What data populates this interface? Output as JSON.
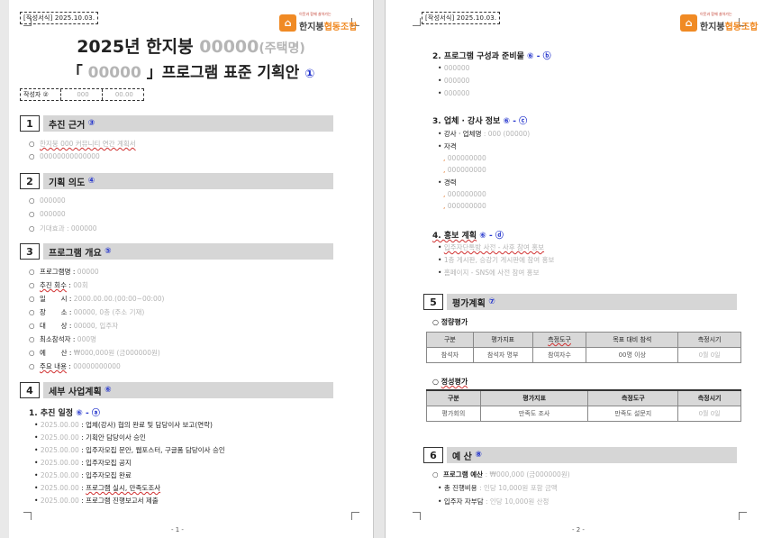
{
  "header": {
    "tag": "[작성서식] 2025.10.03.",
    "logo_sub": "이웃과 함께 살아가는",
    "logo_main": "한지붕",
    "logo_accent": "협동조합"
  },
  "page1": {
    "title_year": "2025년 한지붕",
    "title_code": "00000",
    "title_suffix": "(주택명)",
    "subtitle_open": "「",
    "subtitle_code": "00000",
    "subtitle_rest": "」프로그램 표준 기획안",
    "subtitle_mark": "①",
    "author_label": "작성자 ②",
    "author_v1": "000",
    "author_v2": "00.00",
    "sections": [
      {
        "num": "1",
        "title": "추진 근거",
        "mark": "③"
      },
      {
        "num": "2",
        "title": "기획 의도",
        "mark": "④"
      },
      {
        "num": "3",
        "title": "프로그램 개요",
        "mark": "⑤"
      },
      {
        "num": "4",
        "title": "세부 사업계획",
        "mark": "⑥"
      }
    ],
    "s1_lines": [
      "한지붕 000 커뮤니티 연간 계획서",
      "00000000000000"
    ],
    "s2_lines": [
      "000000",
      "000000",
      "기대효과 : 000000"
    ],
    "s3_rows": [
      {
        "label": "프로그램명",
        "value": "00000"
      },
      {
        "label": "추진 회수",
        "value": "00회"
      },
      {
        "label": "일       시",
        "value": "2000.00.00.(00:00~00:00)"
      },
      {
        "label": "장       소",
        "value": "00000, 0층 (주소 기재)"
      },
      {
        "label": "대       상",
        "value": "00000, 입주자"
      },
      {
        "label": "최소참석자",
        "value": "000명"
      },
      {
        "label": "예       산",
        "value": "₩000,000원 (금000000원)"
      },
      {
        "label": "주요 내용",
        "value": "00000000000"
      }
    ],
    "plan_heading": "1. 추진 일정",
    "plan_mark": "⑥ - ⓐ",
    "plan_rows": [
      {
        "date": "2025.00.00",
        "text": "업체(강사) 협의 완료 및 담당이사 보고(연락)"
      },
      {
        "date": "2025.00.00",
        "text": "기획안 담당이사 승인"
      },
      {
        "date": "2025.00.00",
        "text": "입주자모집 문안, 웹포스터, 구글폼 담당이사 승인"
      },
      {
        "date": "2025.00.00",
        "text": "입주자모집 공지"
      },
      {
        "date": "2025.00.00",
        "text": "입주자모집 완료"
      },
      {
        "date": "2025.00.00",
        "text": "프로그램 실시, 만족도조사"
      },
      {
        "date": "2025.00.00",
        "text": "프로그램 진행보고서 제출"
      }
    ],
    "page_no": "- 1 -"
  },
  "page2": {
    "h2": "2. 프로그램 구성과 준비물",
    "h2_mark": "⑥ - ⓑ",
    "h2_lines": [
      "000000",
      "000000",
      "000000"
    ],
    "h3": "3. 업체 · 강사 정보",
    "h3_mark": "⑥ - ⓒ",
    "h3_line1_label": "강사 · 업체명",
    "h3_line1_value": ": 000 (00000)",
    "h3_career_label": "자격",
    "h3_career": [
      "000000000",
      "000000000"
    ],
    "h3_exp_label": "경력",
    "h3_exp": [
      "000000000",
      "000000000"
    ],
    "h4": "4. 홍보 계획",
    "h4_mark": "⑥ - ⓓ",
    "h4_lines": [
      "입주자단톡방 사전 - 사후 참여 홍보",
      "1층 게시판, 승강기 게시판에 참여 홍보",
      "홈페이지 - SNS에 사전 참여 홍보"
    ],
    "sec5_num": "5",
    "sec5_title": "평가계획",
    "sec5_mark": "⑦",
    "quant_title": "정량평가",
    "quant_headers": [
      "구분",
      "평가지표",
      "측정도구",
      "목표 대비 참석",
      "측정시기"
    ],
    "quant_row": [
      "참석자",
      "참석자 명부",
      "참여자수",
      "00명 이상",
      "0월 0일"
    ],
    "qual_title": "정성평가",
    "qual_headers": [
      "구분",
      "평가지표",
      "측정도구",
      "측정시기"
    ],
    "qual_row": [
      "평가회의",
      "만족도 조사",
      "만족도 설문지",
      "0월 0일"
    ],
    "sec6_num": "6",
    "sec6_title": "예 산",
    "sec6_mark": "⑧",
    "budget_line": "프로그램 예산",
    "budget_value": ": ₩000,000 (금000000원)",
    "budget_total_label": "총 진행비용",
    "budget_total_value": ": 인당 10,000원 포함 금액",
    "budget_self_label": "입주자 자부담",
    "budget_self_value": ": 인당 10,000원 산정",
    "page_no": "- 2 -"
  }
}
